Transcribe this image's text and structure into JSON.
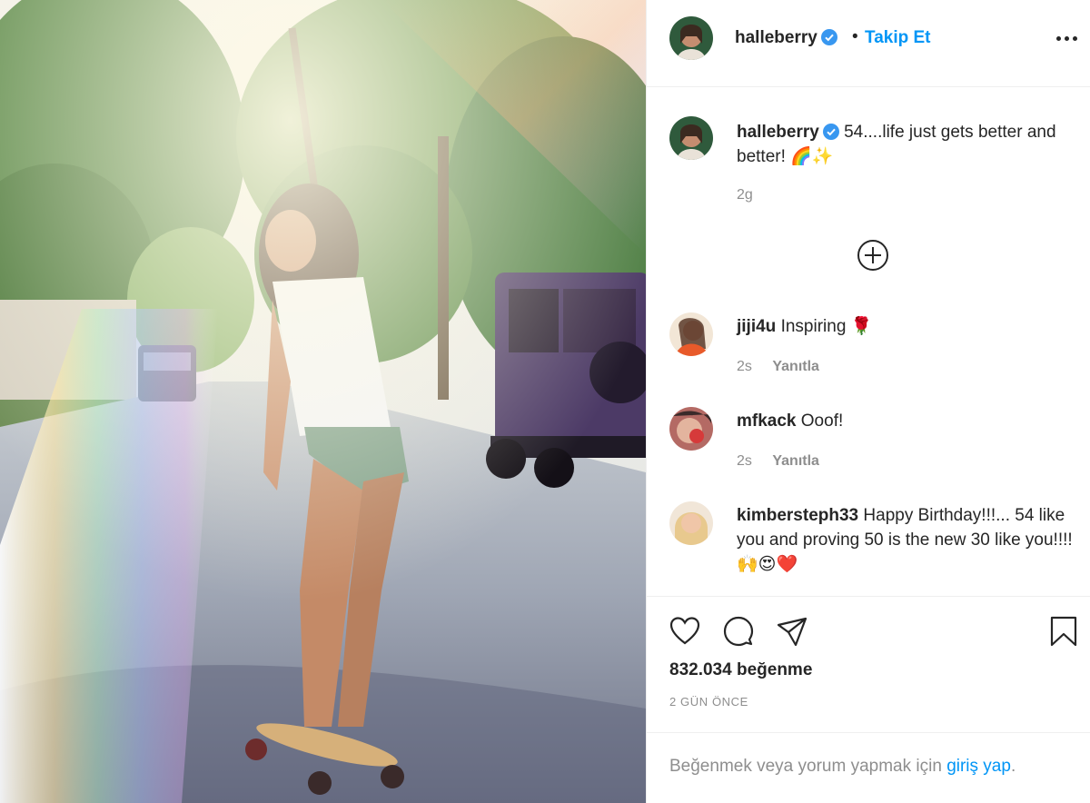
{
  "post": {
    "image_alt": "Woman riding a skateboard on a sunny tree-lined street"
  },
  "header": {
    "username": "halleberry",
    "separator": "•",
    "follow_label": "Takip Et",
    "more_icon": "more-horizontal-icon"
  },
  "caption": {
    "username": "halleberry",
    "text": "54....life just gets better and better!",
    "emoji": "🌈✨",
    "time": "2g"
  },
  "load_more_icon": "plus-circle-icon",
  "comments": [
    {
      "username": "jiji4u",
      "text": "Inspiring",
      "emoji": "🌹",
      "time": "2s",
      "reply_label": "Yanıtla"
    },
    {
      "username": "mfkack",
      "text": "Ooof!",
      "emoji": "",
      "time": "2s",
      "reply_label": "Yanıtla"
    },
    {
      "username": "kimbersteph33",
      "text": "Happy Birthday!!!... 54 like you and proving 50 is the new 30 like you!!!!",
      "emoji": "🙌😍❤️"
    }
  ],
  "actions": {
    "like_icon": "heart-icon",
    "comment_icon": "comment-icon",
    "share_icon": "send-icon",
    "save_icon": "bookmark-icon",
    "likes_count": "832.034",
    "likes_label": "beğenme",
    "time_ago": "2 GÜN ÖNCE"
  },
  "login": {
    "prompt": "Beğenmek veya yorum yapmak için ",
    "link": "giriş yap",
    "suffix": "."
  },
  "colors": {
    "link_blue": "#0095f6",
    "text": "#262626",
    "muted": "#8e8e8e",
    "border": "#efefef",
    "verified_blue": "#3897f0"
  }
}
